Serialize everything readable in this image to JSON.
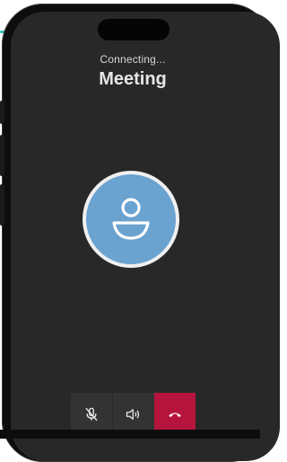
{
  "call": {
    "status": "Connecting...",
    "title": "Meeting"
  },
  "controls": [
    {
      "name": "mute",
      "icon": "microphone-off-icon"
    },
    {
      "name": "speaker",
      "icon": "speaker-icon"
    },
    {
      "name": "end-call",
      "icon": "phone-hangup-icon"
    }
  ],
  "colors": {
    "screen_bg": "#282828",
    "avatar_bg": "#6aa2d0",
    "end_call": "#b5153d",
    "accent": "#2fc3b2"
  }
}
